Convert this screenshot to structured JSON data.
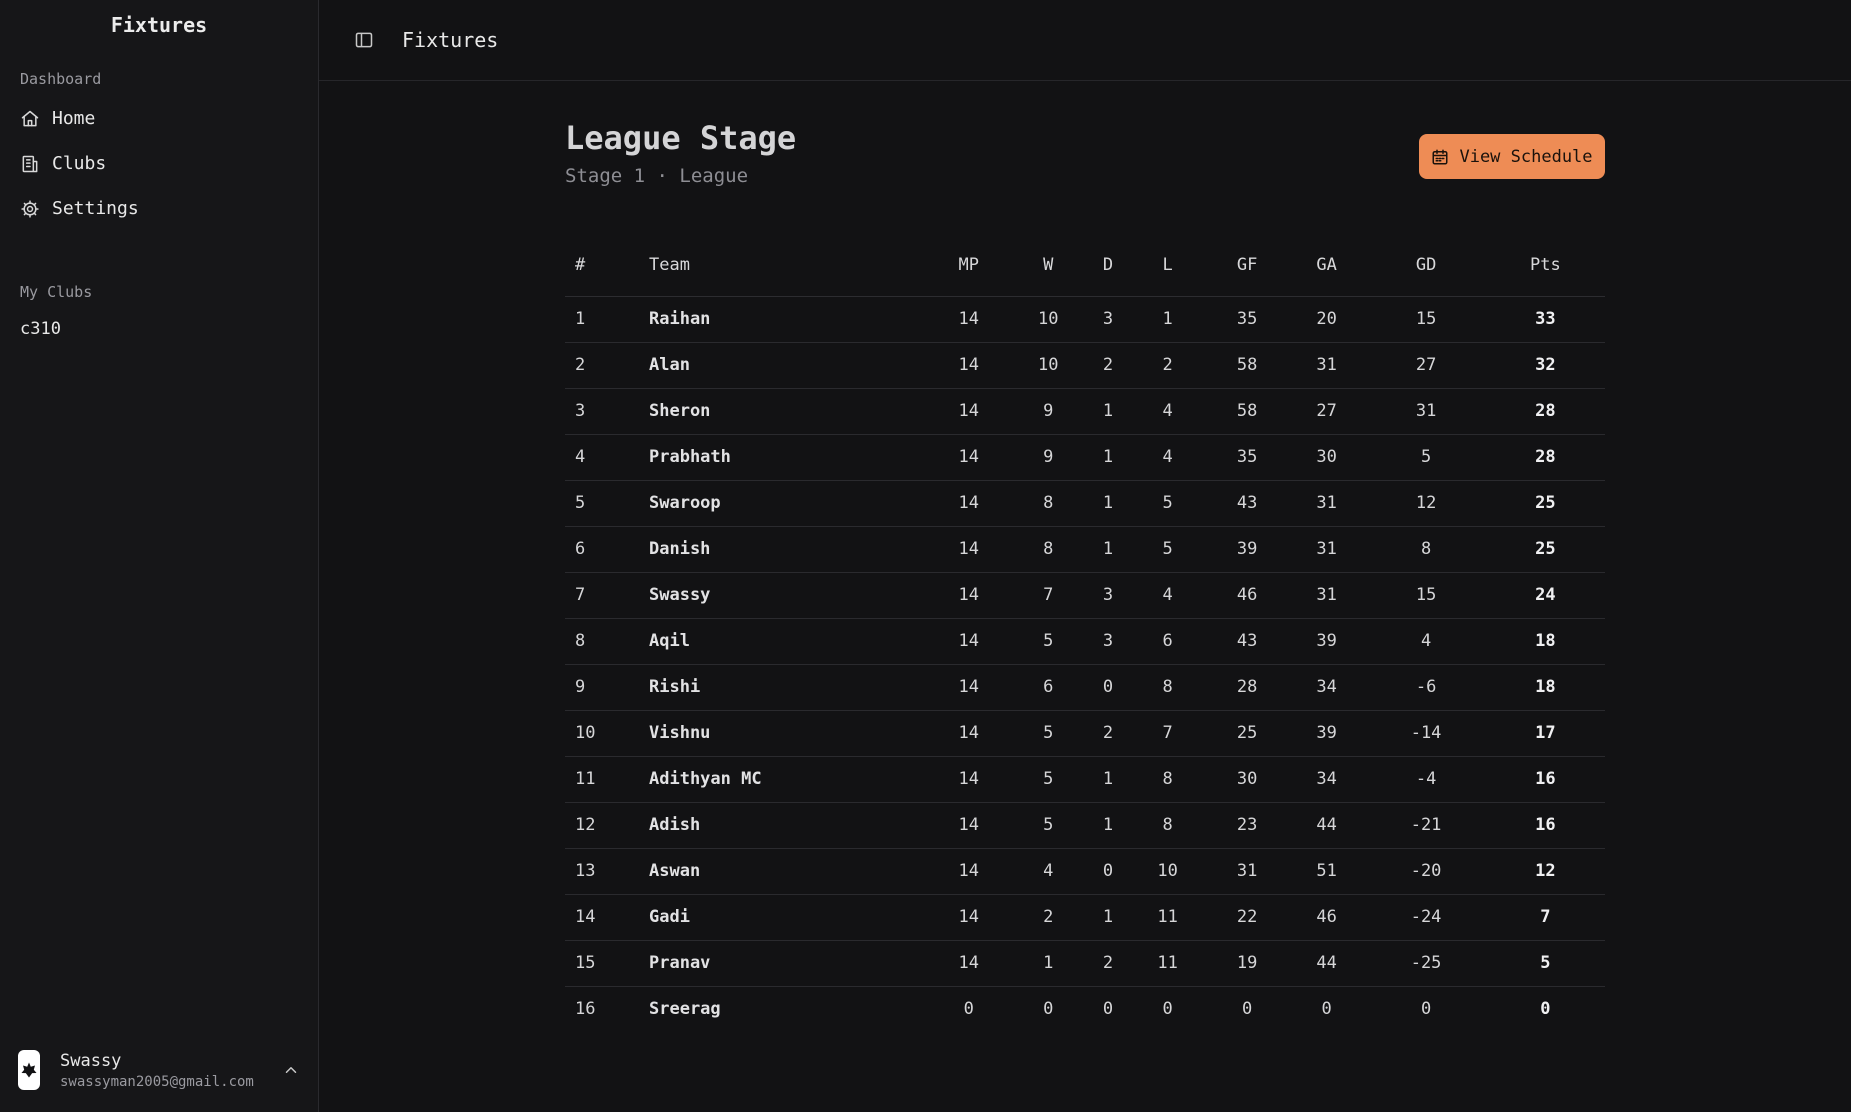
{
  "sidebar": {
    "brand": "Fixtures",
    "dashboard_label": "Dashboard",
    "nav": [
      {
        "label": "Home",
        "icon": "home-icon"
      },
      {
        "label": "Clubs",
        "icon": "building-icon"
      },
      {
        "label": "Settings",
        "icon": "gear-icon"
      }
    ],
    "my_clubs_label": "My Clubs",
    "clubs": [
      "c310"
    ],
    "user": {
      "name": "Swassy",
      "email": "swassyman2005@gmail.com"
    }
  },
  "topbar": {
    "title": "Fixtures"
  },
  "header": {
    "title": "League Stage",
    "subtitle": "Stage 1 · League",
    "button_label": "View Schedule"
  },
  "table": {
    "columns": [
      "#",
      "Team",
      "MP",
      "W",
      "D",
      "L",
      "GF",
      "GA",
      "GD",
      "Pts"
    ],
    "rows": [
      [
        "1",
        "Raihan",
        "14",
        "10",
        "3",
        "1",
        "35",
        "20",
        "15",
        "33"
      ],
      [
        "2",
        "Alan",
        "14",
        "10",
        "2",
        "2",
        "58",
        "31",
        "27",
        "32"
      ],
      [
        "3",
        "Sheron",
        "14",
        "9",
        "1",
        "4",
        "58",
        "27",
        "31",
        "28"
      ],
      [
        "4",
        "Prabhath",
        "14",
        "9",
        "1",
        "4",
        "35",
        "30",
        "5",
        "28"
      ],
      [
        "5",
        "Swaroop",
        "14",
        "8",
        "1",
        "5",
        "43",
        "31",
        "12",
        "25"
      ],
      [
        "6",
        "Danish",
        "14",
        "8",
        "1",
        "5",
        "39",
        "31",
        "8",
        "25"
      ],
      [
        "7",
        "Swassy",
        "14",
        "7",
        "3",
        "4",
        "46",
        "31",
        "15",
        "24"
      ],
      [
        "8",
        "Aqil",
        "14",
        "5",
        "3",
        "6",
        "43",
        "39",
        "4",
        "18"
      ],
      [
        "9",
        "Rishi",
        "14",
        "6",
        "0",
        "8",
        "28",
        "34",
        "-6",
        "18"
      ],
      [
        "10",
        "Vishnu",
        "14",
        "5",
        "2",
        "7",
        "25",
        "39",
        "-14",
        "17"
      ],
      [
        "11",
        "Adithyan MC",
        "14",
        "5",
        "1",
        "8",
        "30",
        "34",
        "-4",
        "16"
      ],
      [
        "12",
        "Adish",
        "14",
        "5",
        "1",
        "8",
        "23",
        "44",
        "-21",
        "16"
      ],
      [
        "13",
        "Aswan",
        "14",
        "4",
        "0",
        "10",
        "31",
        "51",
        "-20",
        "12"
      ],
      [
        "14",
        "Gadi",
        "14",
        "2",
        "1",
        "11",
        "22",
        "46",
        "-24",
        "7"
      ],
      [
        "15",
        "Pranav",
        "14",
        "1",
        "2",
        "11",
        "19",
        "44",
        "-25",
        "5"
      ],
      [
        "16",
        "Sreerag",
        "0",
        "0",
        "0",
        "0",
        "0",
        "0",
        "0",
        "0"
      ]
    ]
  },
  "colors": {
    "accent": "#ee8c55",
    "background": "#121214",
    "sidebar": "#161618"
  }
}
